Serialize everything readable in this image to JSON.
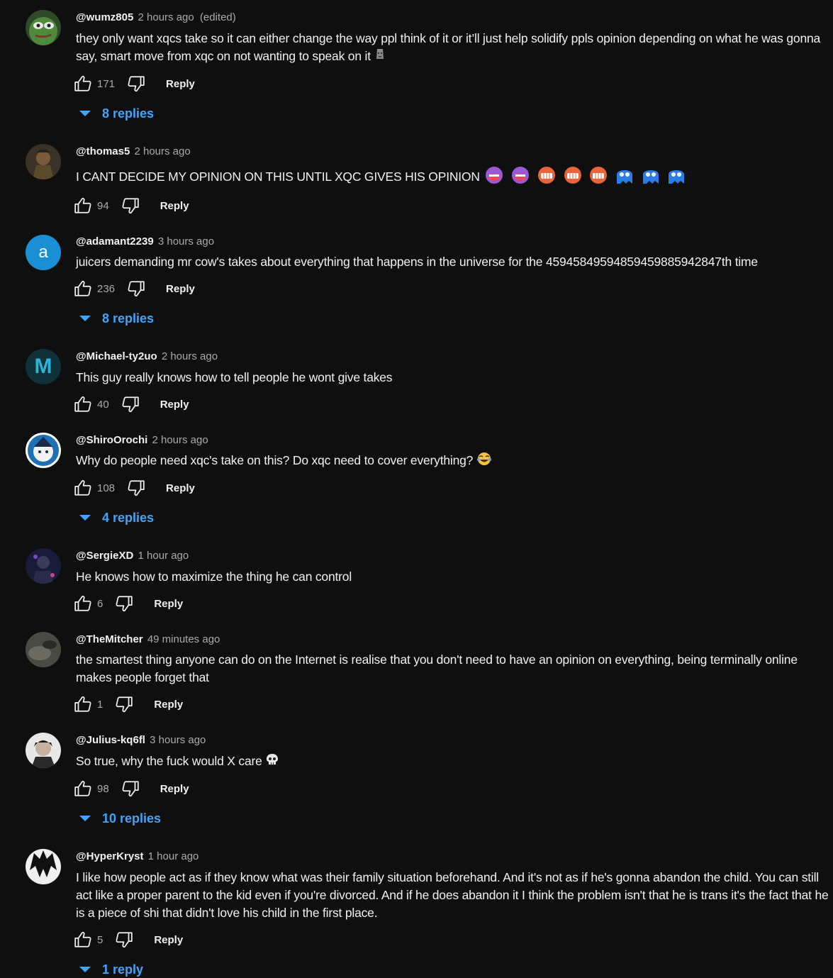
{
  "colors": {
    "background": "#0f0f0f",
    "text": "#f1f1f1",
    "muted": "#aaaaaa",
    "link": "#3ea6ff"
  },
  "comments": [
    {
      "author": "@wumz805",
      "time": "2 hours ago",
      "edited": "(edited)",
      "text": "they only want xqcs take so it can either change the way ppl think of it or it’ll just help solidify ppls opinion depending on what he was gonna say, smart move from xqc on not wanting to speak on it",
      "emoji_icons": [
        "moai-icon"
      ],
      "likes": "171",
      "reply_label": "Reply",
      "replies": "8 replies",
      "avatar_icon": "pepe-avatar-icon"
    },
    {
      "author": "@thomas5",
      "time": "2 hours ago",
      "text": "I CANT DECIDE MY OPINION ON THIS UNTIL XQC GIVES HIS OPINION",
      "emoji_icons": [
        "laughing-face-icon",
        "laughing-face-icon",
        "teeth-face-icon",
        "teeth-face-icon",
        "teeth-face-icon",
        "ghost-icon",
        "ghost-icon",
        "ghost-icon"
      ],
      "likes": "94",
      "reply_label": "Reply",
      "avatar_icon": "character-avatar-icon"
    },
    {
      "author": "@adamant2239",
      "time": "3 hours ago",
      "text": "juicers demanding mr cow's takes about everything that happens in the universe for the 459458495948594598859428 47th time",
      "text_exact": "juicers demanding mr cow's takes about everything that happens in the universe for the 45945849594859459885942847th time",
      "likes": "236",
      "reply_label": "Reply",
      "replies": "8 replies",
      "avatar_letter": "a",
      "avatar_color": "#1a8fd6"
    },
    {
      "author": "@Michael-ty2uo",
      "time": "2 hours ago",
      "text": "This guy really knows how to tell people he wont give takes",
      "likes": "40",
      "reply_label": "Reply",
      "avatar_letter": "M",
      "avatar_color": "#2bb3d9"
    },
    {
      "author": "@ShiroOrochi",
      "time": "2 hours ago",
      "text": "Why do people need xqc's take on this? Do xqc need to cover everything?",
      "emoji_icons": [
        "tears-of-joy-icon"
      ],
      "likes": "108",
      "reply_label": "Reply",
      "replies": "4 replies",
      "avatar_icon": "anime-avatar-icon"
    },
    {
      "author": "@SergieXD",
      "time": "1 hour ago",
      "text": "He knows how to maximize the thing he can control",
      "likes": "6",
      "reply_label": "Reply",
      "avatar_icon": "dark-avatar-icon"
    },
    {
      "author": "@TheMitcher",
      "time": "49 minutes ago",
      "text": "the smartest thing anyone can do on the Internet is realise that you don't need to have an opinion on everything, being terminally online makes people forget that",
      "likes": "1",
      "reply_label": "Reply",
      "avatar_icon": "photo-avatar-icon"
    },
    {
      "author": "@Julius-kq6fl",
      "time": "3 hours ago",
      "text": "So true, why the fuck would X care",
      "emoji_icons": [
        "skull-icon"
      ],
      "likes": "98",
      "reply_label": "Reply",
      "replies": "10 replies",
      "avatar_icon": "portrait-avatar-icon"
    },
    {
      "author": "@HyperKryst",
      "time": "1 hour ago",
      "text": "I like how people act as if they know what was their family situation beforehand. And it's not as if he's gonna abandon the child. You can still act like a proper parent to the kid even if you're divorced. And if he does abandon it I think the problem isn't that he is trans it's the fact that he is a piece of shi  that didn't love his child in the first place.",
      "likes": "5",
      "reply_label": "Reply",
      "replies": "1 reply",
      "avatar_icon": "manga-avatar-icon"
    }
  ]
}
